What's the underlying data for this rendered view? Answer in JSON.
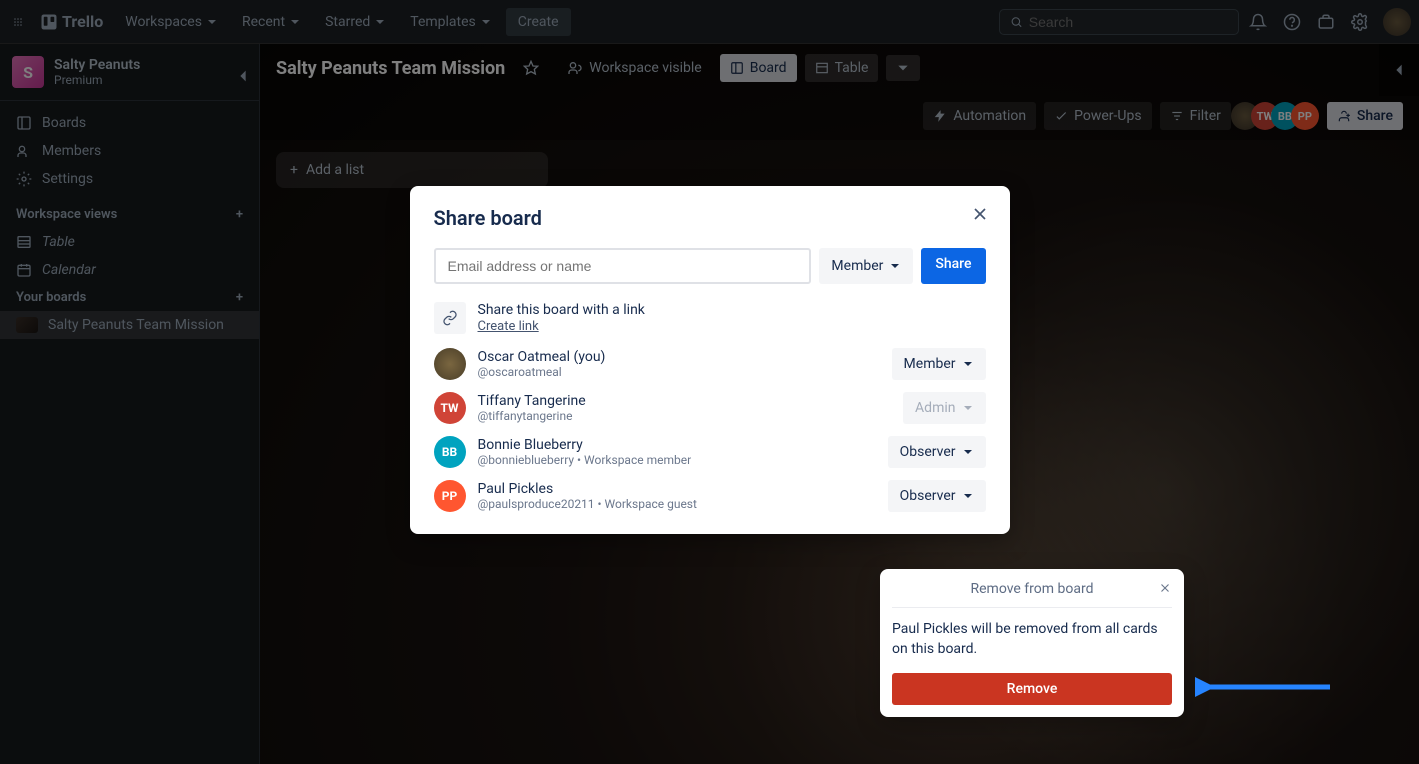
{
  "topnav": {
    "logo_text": "Trello",
    "items": [
      "Workspaces",
      "Recent",
      "Starred",
      "Templates"
    ],
    "create": "Create",
    "search_placeholder": "Search"
  },
  "sidebar": {
    "workspace_initial": "S",
    "workspace_name": "Salty Peanuts",
    "workspace_plan": "Premium",
    "nav": {
      "boards": "Boards",
      "members": "Members",
      "settings": "Settings"
    },
    "views_header": "Workspace views",
    "views": {
      "table": "Table",
      "calendar": "Calendar"
    },
    "your_boards_header": "Your boards",
    "your_boards": [
      "Salty Peanuts Team Mission"
    ]
  },
  "board": {
    "title": "Salty Peanuts Team Mission",
    "visibility": "Workspace visible",
    "view_board": "Board",
    "view_table": "Table",
    "automation": "Automation",
    "powerups": "Power-Ups",
    "filter": "Filter",
    "share": "Share",
    "add_list": "Add a list",
    "member_chips": [
      "",
      "TW",
      "BB",
      "PP"
    ]
  },
  "modal": {
    "title": "Share board",
    "input_placeholder": "Email address or name",
    "role_default": "Member",
    "share_btn": "Share",
    "link_title": "Share this board with a link",
    "link_action": "Create link",
    "members": [
      {
        "name": "Oscar Oatmeal (you)",
        "handle": "@oscaroatmeal",
        "role": "Member",
        "chip": "",
        "cls": "oscar",
        "disabled": false
      },
      {
        "name": "Tiffany Tangerine",
        "handle": "@tiffanytangerine",
        "role": "Admin",
        "chip": "TW",
        "cls": "tw",
        "disabled": true
      },
      {
        "name": "Bonnie Blueberry",
        "handle": "@bonnieblueberry • Workspace member",
        "role": "Observer",
        "chip": "BB",
        "cls": "bb",
        "disabled": false
      },
      {
        "name": "Paul Pickles",
        "handle": "@paulsproduce20211 • Workspace guest",
        "role": "Observer",
        "chip": "PP",
        "cls": "pp",
        "disabled": false
      }
    ]
  },
  "popover": {
    "title": "Remove from board",
    "text": "Paul Pickles will be removed from all cards on this board.",
    "button": "Remove"
  }
}
